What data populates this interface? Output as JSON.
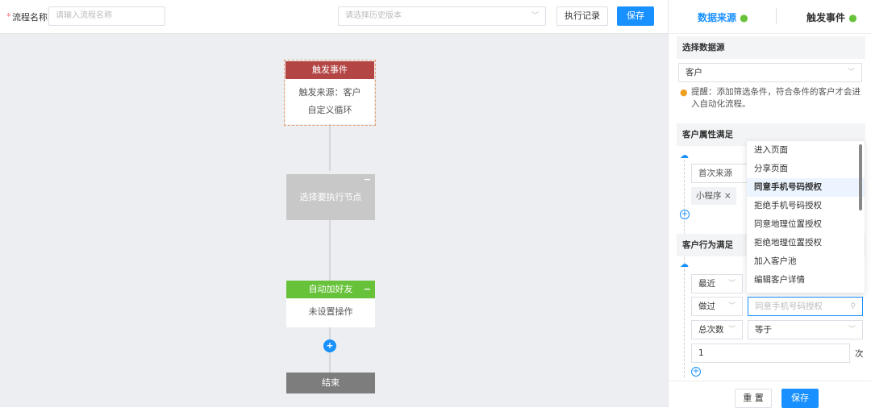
{
  "header": {
    "flow_name_label": "流程名称",
    "required_mark": "*",
    "flow_name_placeholder": "请输入流程名称",
    "version_placeholder": "请选择历史版本",
    "history_button": "执行记录",
    "save_button": "保存"
  },
  "flow": {
    "trigger": {
      "title": "触发事件",
      "line1": "触发来源：客户",
      "line2": "自定义循环"
    },
    "select_node": {
      "label": "选择要执行节点"
    },
    "add_friend": {
      "title": "自动加好友",
      "body": "未设置操作"
    },
    "end": {
      "label": "结束"
    }
  },
  "panel": {
    "tabs": [
      {
        "label": "数据来源"
      },
      {
        "label": "触发事件"
      }
    ],
    "source_section": "选择数据源",
    "source_value": "客户",
    "tip": "提醒：添加筛选条件，符合条件的客户才会进入自动化流程。",
    "attr_section": "客户属性满足",
    "attr_field": "首次来源",
    "attr_tag": "小程序",
    "behavior_section": "客户行为满足",
    "recent": "最近",
    "did": "做过",
    "action_placeholder": "同意手机号码授权",
    "count_type": "总次数",
    "operator": "等于",
    "count_value": "1",
    "count_unit": "次",
    "reset_button": "重 置",
    "save_button": "保存",
    "dropdown": [
      "进入页面",
      "分享页面",
      "同意手机号码授权",
      "拒绝手机号码授权",
      "同意地理位置授权",
      "拒绝地理位置授权",
      "加入客户池",
      "编辑客户详情"
    ]
  },
  "colors": {
    "accent": "#1890ff",
    "trigger": "#b44545",
    "green": "#67c23a",
    "end": "#7d7d7d"
  }
}
